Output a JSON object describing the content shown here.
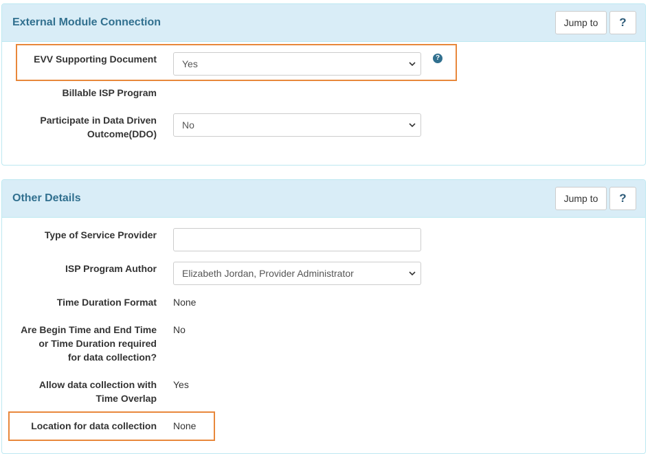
{
  "sections": [
    {
      "title": "External Module Connection",
      "jump_label": "Jump to",
      "help_label": "?",
      "fields": {
        "evv_supporting_document": {
          "label": "EVV Supporting Document",
          "value": "Yes"
        },
        "billable_isp_program": {
          "label": "Billable ISP Program"
        },
        "participate_ddo": {
          "label_line1": "Participate in Data Driven",
          "label_line2": "Outcome(DDO)",
          "value": "No"
        }
      }
    },
    {
      "title": "Other Details",
      "jump_label": "Jump to",
      "help_label": "?",
      "fields": {
        "type_of_service_provider": {
          "label": "Type of Service Provider",
          "value": ""
        },
        "isp_program_author": {
          "label": "ISP Program Author",
          "value": "Elizabeth Jordan, Provider Administrator"
        },
        "time_duration_format": {
          "label": "Time Duration Format",
          "value": "None"
        },
        "begin_end_required": {
          "label_line1": "Are Begin Time and End Time",
          "label_line2": "or Time Duration required",
          "label_line3": "for data collection?",
          "value": "No"
        },
        "allow_overlap": {
          "label_line1": "Allow data collection with",
          "label_line2": "Time Overlap",
          "value": "Yes"
        },
        "location": {
          "label": "Location for data collection",
          "value": "None"
        }
      }
    }
  ],
  "icons": {
    "field_help": "question-circle-icon",
    "select_arrow": "chevron-down-icon"
  },
  "colors": {
    "heading_bg": "#d9edf7",
    "heading_text": "#31708f",
    "highlight": "#e8873a"
  }
}
